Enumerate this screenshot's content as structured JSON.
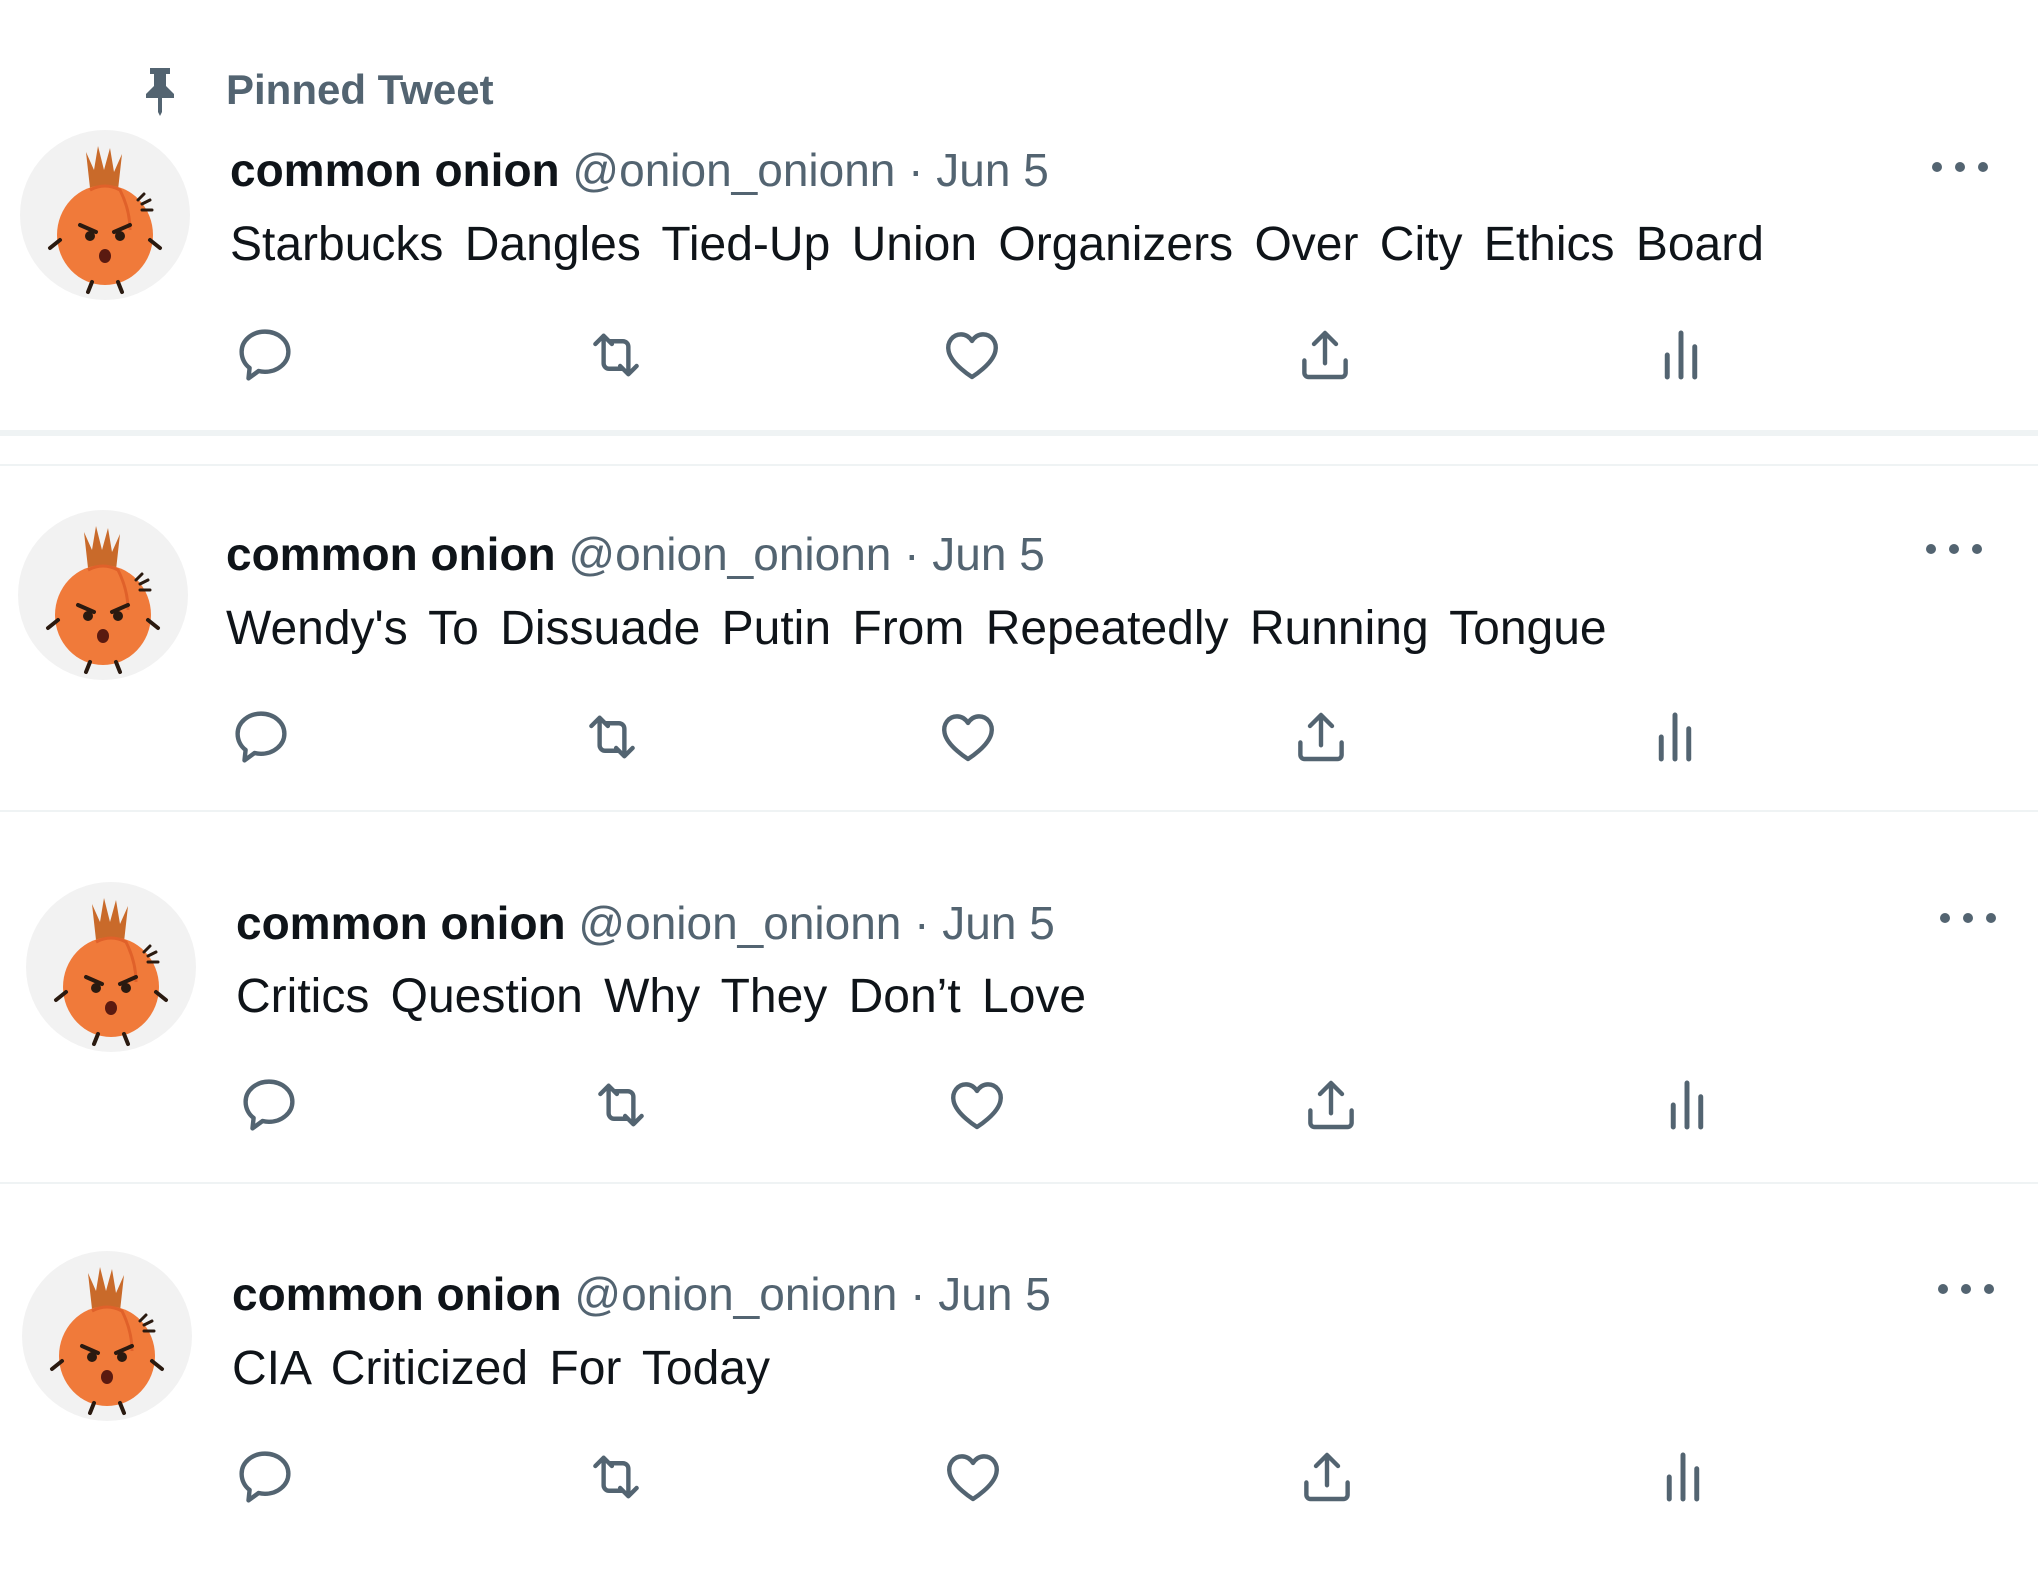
{
  "pinned_label": "Pinned Tweet",
  "colors": {
    "text_primary": "#0f1419",
    "text_secondary": "#536471",
    "divider": "#eff3f4",
    "onion_body": "#f07a3a",
    "onion_stem": "#c96a2a"
  },
  "icons": [
    "pin-icon",
    "reply-icon",
    "retweet-icon",
    "like-icon",
    "share-icon",
    "analytics-icon",
    "more-icon",
    "onion-avatar"
  ],
  "tweets": [
    {
      "name": "common onion",
      "handle": "@onion_onionn",
      "separator": "·",
      "date": "Jun 5",
      "text": "Starbucks Dangles Tied-Up Union Organizers Over City Ethics Board",
      "pinned": true
    },
    {
      "name": "common onion",
      "handle": "@onion_onionn",
      "separator": "·",
      "date": "Jun 5",
      "text": "Wendy's To Dissuade Putin From Repeatedly Running Tongue",
      "pinned": false
    },
    {
      "name": "common onion",
      "handle": "@onion_onionn",
      "separator": "·",
      "date": "Jun 5",
      "text": "Critics Question Why They Don’t Love",
      "pinned": false
    },
    {
      "name": "common onion",
      "handle": "@onion_onionn",
      "separator": "·",
      "date": "Jun 5",
      "text": "CIA Criticized For Today",
      "pinned": false
    }
  ]
}
